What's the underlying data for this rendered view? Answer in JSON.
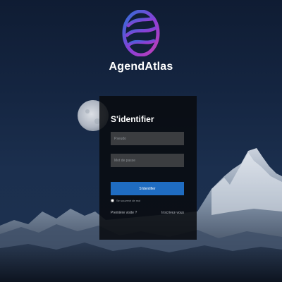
{
  "brand": {
    "name": "AgendAtlas",
    "logo_icon": "swirl-globe-logo",
    "colors": [
      "#2f6fd8",
      "#8b3fd6",
      "#c23fb5"
    ]
  },
  "login": {
    "title": "S'identifier",
    "username_placeholder": "Pseudo",
    "password_placeholder": "Mot de passe",
    "submit_label": "S'identifier",
    "remember_label": "Se souvenir de moi",
    "first_visit_link": "Première visite ?",
    "register_link": "Inscrivez-vous"
  },
  "theme": {
    "accent": "#1f6cc1",
    "card_bg": "#0a0c10",
    "field_bg": "#3b3d40"
  }
}
